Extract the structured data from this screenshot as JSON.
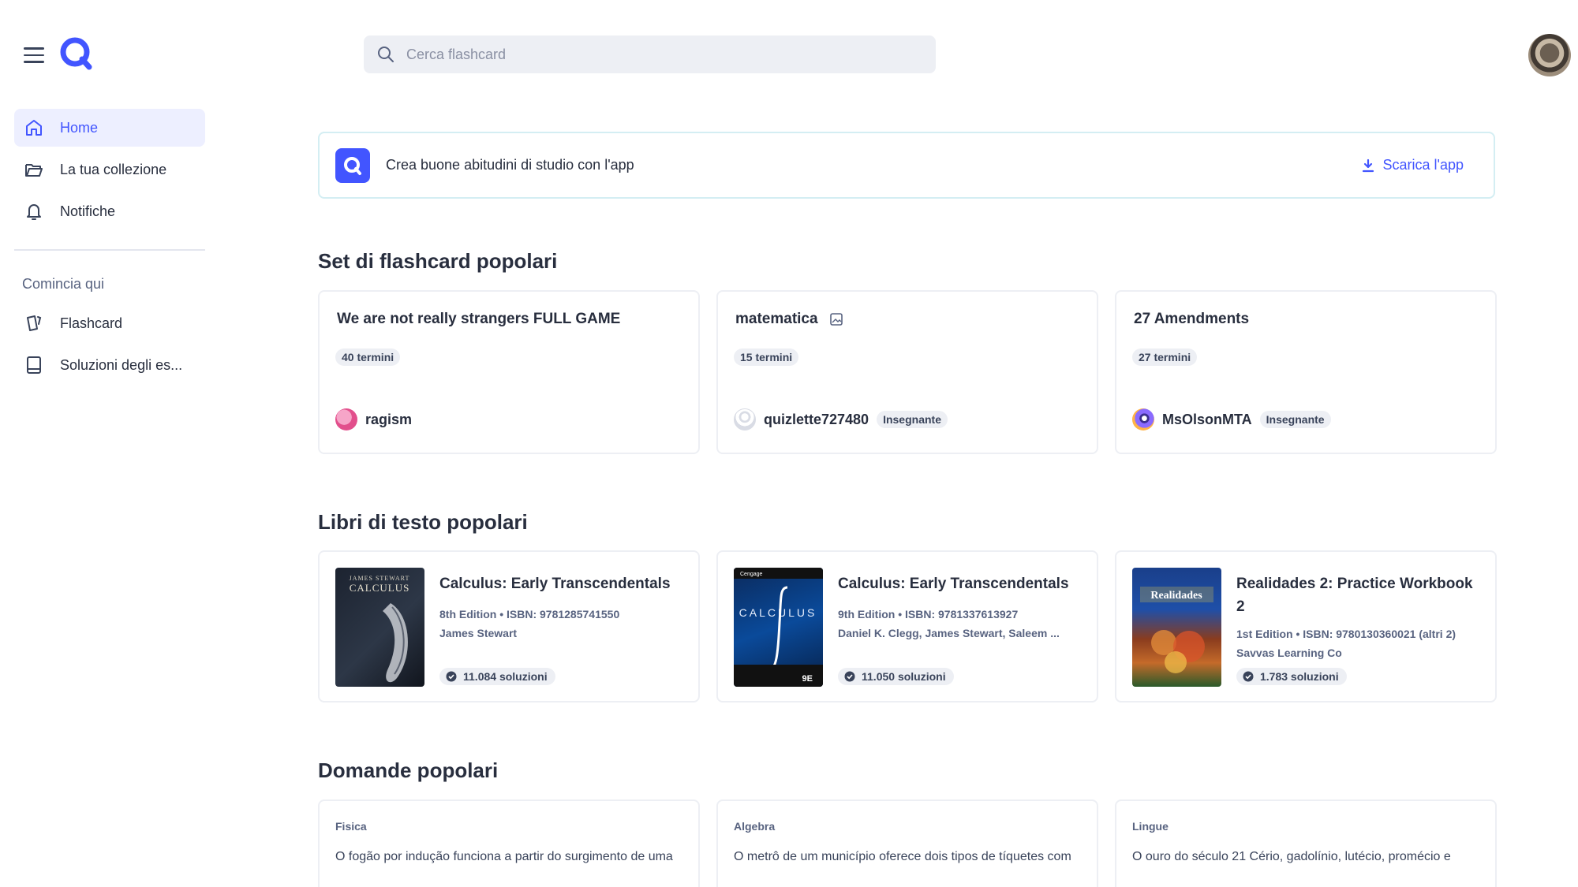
{
  "search": {
    "placeholder": "Cerca flashcard"
  },
  "sidebar": {
    "items": [
      {
        "label": "Home",
        "icon": "home-icon",
        "active": true
      },
      {
        "label": "La tua collezione",
        "icon": "folder-icon",
        "active": false
      },
      {
        "label": "Notifiche",
        "icon": "bell-icon",
        "active": false
      }
    ],
    "section_title": "Comincia qui",
    "start_items": [
      {
        "label": "Flashcard",
        "icon": "flashcards-icon"
      },
      {
        "label": "Soluzioni degli es...",
        "icon": "book-icon"
      }
    ]
  },
  "banner": {
    "message": "Crea buone abitudini di studio con l'app",
    "download_label": "Scarica l'app"
  },
  "flashcard_sets": {
    "title": "Set di flashcard popolari",
    "items": [
      {
        "title": "We are not really strangers FULL GAME",
        "terms": "40 termini",
        "user": "ragism",
        "badge": "",
        "has_image_icon": false
      },
      {
        "title": "matematica",
        "terms": "15 termini",
        "user": "quizlette727480",
        "badge": "Insegnante",
        "has_image_icon": true
      },
      {
        "title": "27 Amendments",
        "terms": "27 termini",
        "user": "MsOlsonMTA",
        "badge": "Insegnante",
        "has_image_icon": false
      }
    ]
  },
  "textbooks": {
    "title": "Libri di testo popolari",
    "items": [
      {
        "title": "Calculus: Early Transcendentals",
        "meta": "8th Edition • ISBN: 9781285741550",
        "authors": "James Stewart",
        "solutions": "11.084 soluzioni"
      },
      {
        "title": "Calculus: Early Transcendentals",
        "meta": "9th Edition • ISBN: 9781337613927",
        "authors": "Daniel K. Clegg, James Stewart, Saleem ...",
        "solutions": "11.050 soluzioni"
      },
      {
        "title": "Realidades 2: Practice Workbook 2",
        "meta": "1st Edition • ISBN: 9780130360021 (altri 2)",
        "authors": "Savvas Learning Co",
        "solutions": "1.783 soluzioni"
      }
    ],
    "cover_texts": {
      "stewart8_author": "JAMES STEWART",
      "stewart8_title": "CALCULUS",
      "clegg9_publisher": "Cengage",
      "clegg9_title": "CALCULUS",
      "clegg9_edition": "9E",
      "realidades_title": "Realidades"
    }
  },
  "questions": {
    "title": "Domande popolari",
    "items": [
      {
        "subject": "Fisica",
        "text": "O fogão por indução funciona a partir do surgimento de uma"
      },
      {
        "subject": "Algebra",
        "text": "O metrô de um município oferece dois tipos de tíquetes com"
      },
      {
        "subject": "Lingue",
        "text": "O ouro do século 21 Cério, gadolínio, lutécio, promécio e"
      }
    ]
  },
  "colors": {
    "accent": "#4255ff",
    "text": "#282e3e",
    "muted": "#586380",
    "pill_bg": "#edeff4"
  }
}
